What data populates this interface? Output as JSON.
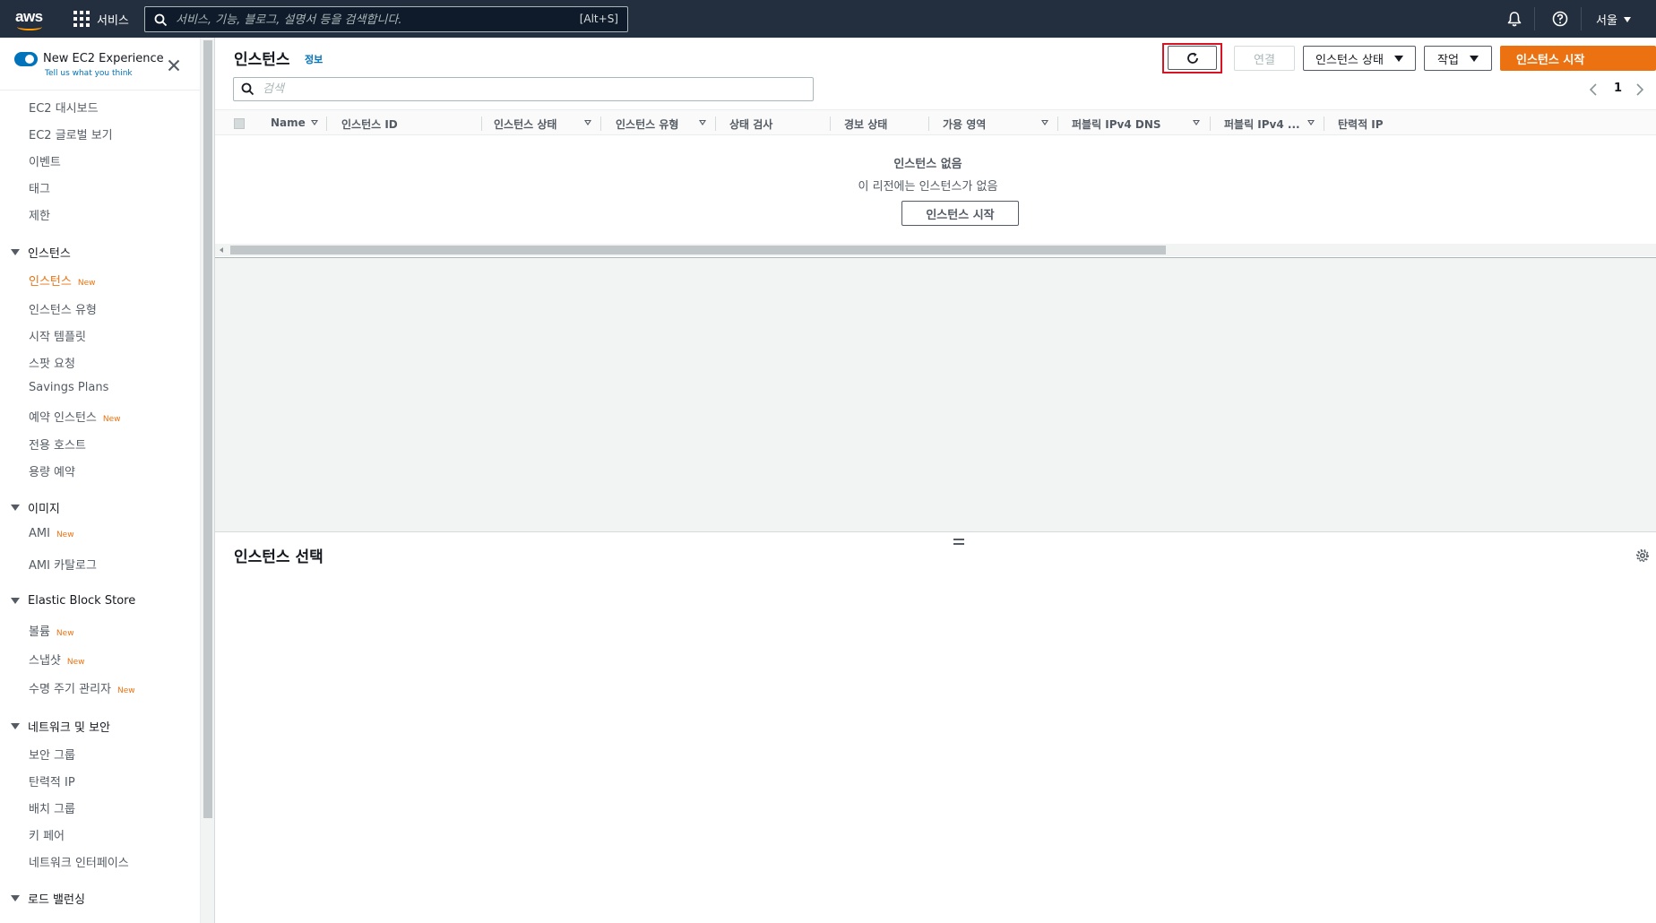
{
  "topnav": {
    "logo": "aws",
    "services_label": "서비스",
    "search_placeholder": "서비스, 기능, 블로그, 설명서 등을 검색합니다.",
    "search_shortcut": "[Alt+S]",
    "icons": [
      "bell-icon",
      "help-icon"
    ],
    "region": "서울"
  },
  "sidebar": {
    "toggle_label": "New EC2 Experience",
    "toggle_link": "Tell us what you think",
    "toggle_on": true,
    "top_items": [
      "EC2 대시보드",
      "EC2 글로벌 보기",
      "이벤트",
      "태그",
      "제한"
    ],
    "sections": [
      {
        "title": "인스턴스",
        "items": [
          {
            "label": "인스턴스",
            "badge": "New",
            "active": true
          },
          {
            "label": "인스턴스 유형"
          },
          {
            "label": "시작 템플릿"
          },
          {
            "label": "스팟 요청"
          },
          {
            "label": "Savings Plans"
          },
          {
            "label": "예약 인스턴스",
            "badge": "New"
          },
          {
            "label": "전용 호스트"
          },
          {
            "label": "용량 예약"
          }
        ]
      },
      {
        "title": "이미지",
        "items": [
          {
            "label": "AMI",
            "badge": "New"
          },
          {
            "label": "AMI 카탈로그"
          }
        ]
      },
      {
        "title": "Elastic Block Store",
        "items": [
          {
            "label": "볼륨",
            "badge": "New"
          },
          {
            "label": "스냅샷",
            "badge": "New"
          },
          {
            "label": "수명 주기 관리자",
            "badge": "New"
          }
        ]
      },
      {
        "title": "네트워크 및 보안",
        "items": [
          {
            "label": "보안 그룹"
          },
          {
            "label": "탄력적 IP"
          },
          {
            "label": "배치 그룹"
          },
          {
            "label": "키 페어"
          },
          {
            "label": "네트워크 인터페이스"
          }
        ]
      },
      {
        "title": "로드 밸런싱",
        "items": []
      }
    ]
  },
  "main": {
    "title": "인스턴스",
    "info": "정보",
    "toolbar": {
      "refresh_icon": "refresh-icon",
      "connect": "연결",
      "instance_state": "인스턴스 상태",
      "actions": "작업",
      "launch": "인스턴스 시작"
    },
    "filter_placeholder": "검색",
    "pager": {
      "page": "1"
    },
    "columns": [
      "Name",
      "인스턴스 ID",
      "인스턴스 상태",
      "인스턴스 유형",
      "상태 검사",
      "경보 상태",
      "가용 영역",
      "퍼블릭 IPv4 DNS",
      "퍼블릭 IPv4 ...",
      "탄력적 IP"
    ],
    "empty": {
      "title": "인스턴스 없음",
      "subtitle": "이 리전에는 인스턴스가 없음",
      "button": "인스턴스 시작"
    },
    "split_panel": {
      "title": "인스턴스 선택"
    }
  },
  "colors": {
    "nav_bg": "#232f3e",
    "accent_orange": "#ec7211",
    "link_blue": "#0073bb",
    "highlight_red": "#d81324"
  }
}
